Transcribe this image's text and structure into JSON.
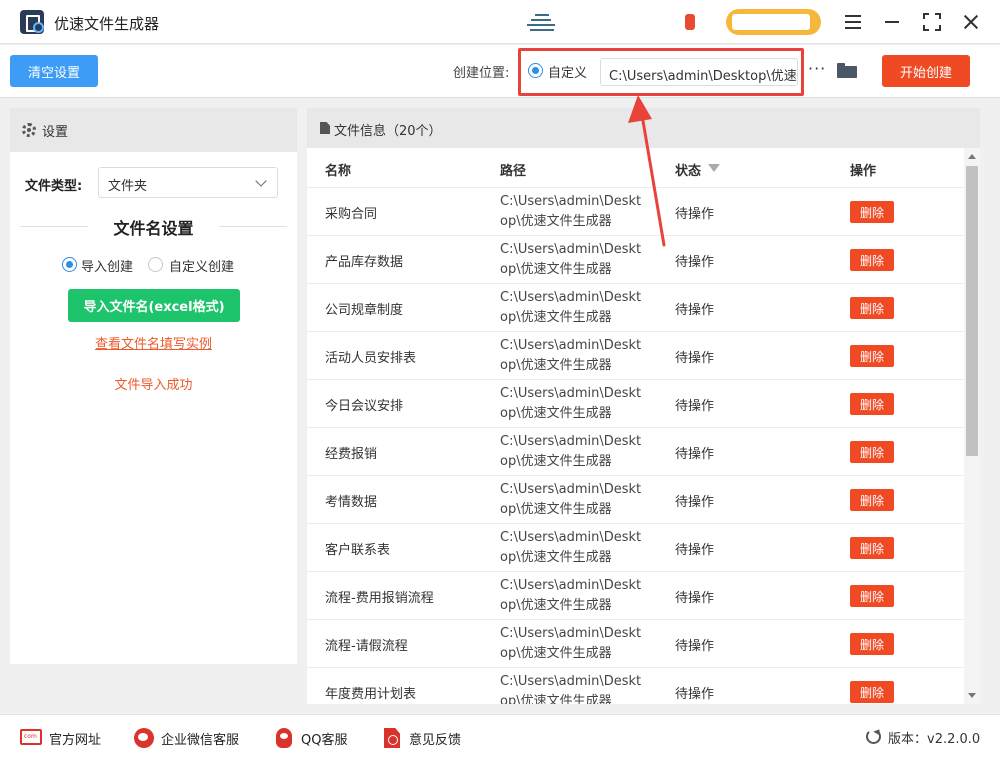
{
  "app": {
    "title": "优速文件生成器"
  },
  "toolbar": {
    "clear_label": "清空设置",
    "location_label": "创建位置:",
    "custom_label": "自定义",
    "path_value": "C:\\Users\\admin\\Desktop\\优速",
    "more_label": "···",
    "start_label": "开始创建"
  },
  "settings": {
    "header": "设置",
    "filetype_label": "文件类型:",
    "filetype_value": "文件夹",
    "section_title": "文件名设置",
    "radio_import": "导入创建",
    "radio_custom": "自定义创建",
    "import_button": "导入文件名(excel格式)",
    "example_link": "查看文件名填写实例",
    "import_status": "文件导入成功"
  },
  "file_info": {
    "header": "文件信息（20个）",
    "columns": {
      "name": "名称",
      "path": "路径",
      "status": "状态",
      "action": "操作"
    },
    "rows": [
      {
        "name": "采购合同",
        "path": "C:\\Users\\admin\\Desktop\\优速文件生成器",
        "status": "待操作",
        "action": "删除"
      },
      {
        "name": "产品库存数据",
        "path": "C:\\Users\\admin\\Desktop\\优速文件生成器",
        "status": "待操作",
        "action": "删除"
      },
      {
        "name": "公司规章制度",
        "path": "C:\\Users\\admin\\Desktop\\优速文件生成器",
        "status": "待操作",
        "action": "删除"
      },
      {
        "name": "活动人员安排表",
        "path": "C:\\Users\\admin\\Desktop\\优速文件生成器",
        "status": "待操作",
        "action": "删除"
      },
      {
        "name": "今日会议安排",
        "path": "C:\\Users\\admin\\Desktop\\优速文件生成器",
        "status": "待操作",
        "action": "删除"
      },
      {
        "name": "经费报销",
        "path": "C:\\Users\\admin\\Desktop\\优速文件生成器",
        "status": "待操作",
        "action": "删除"
      },
      {
        "name": "考情数据",
        "path": "C:\\Users\\admin\\Desktop\\优速文件生成器",
        "status": "待操作",
        "action": "删除"
      },
      {
        "name": "客户联系表",
        "path": "C:\\Users\\admin\\Desktop\\优速文件生成器",
        "status": "待操作",
        "action": "删除"
      },
      {
        "name": "流程-费用报销流程",
        "path": "C:\\Users\\admin\\Desktop\\优速文件生成器",
        "status": "待操作",
        "action": "删除"
      },
      {
        "name": "流程-请假流程",
        "path": "C:\\Users\\admin\\Desktop\\优速文件生成器",
        "status": "待操作",
        "action": "删除"
      },
      {
        "name": "年度费用计划表",
        "path": "C:\\Users\\admin\\Desktop\\优速文件生成器",
        "status": "待操作",
        "action": "删除"
      }
    ]
  },
  "footer": {
    "website": "官方网址",
    "wechat": "企业微信客服",
    "qq": "QQ客服",
    "feedback": "意见反馈",
    "version": "版本：v2.2.0.0"
  },
  "colors": {
    "primary_blue": "#3c9cf6",
    "accent_red": "#ef4a24",
    "import_green": "#1ec46b",
    "link_orange": "#ee5a2c",
    "highlight_red": "#e8433a"
  },
  "icons": [
    "app-logo-icon",
    "menu-icon",
    "minimize-icon",
    "maximize-icon",
    "close-icon",
    "folder-icon",
    "gear-icon",
    "document-icon",
    "chevron-down-icon",
    "filter-icon",
    "website-icon",
    "wechat-icon",
    "qq-icon",
    "pdf-icon",
    "refresh-icon"
  ]
}
